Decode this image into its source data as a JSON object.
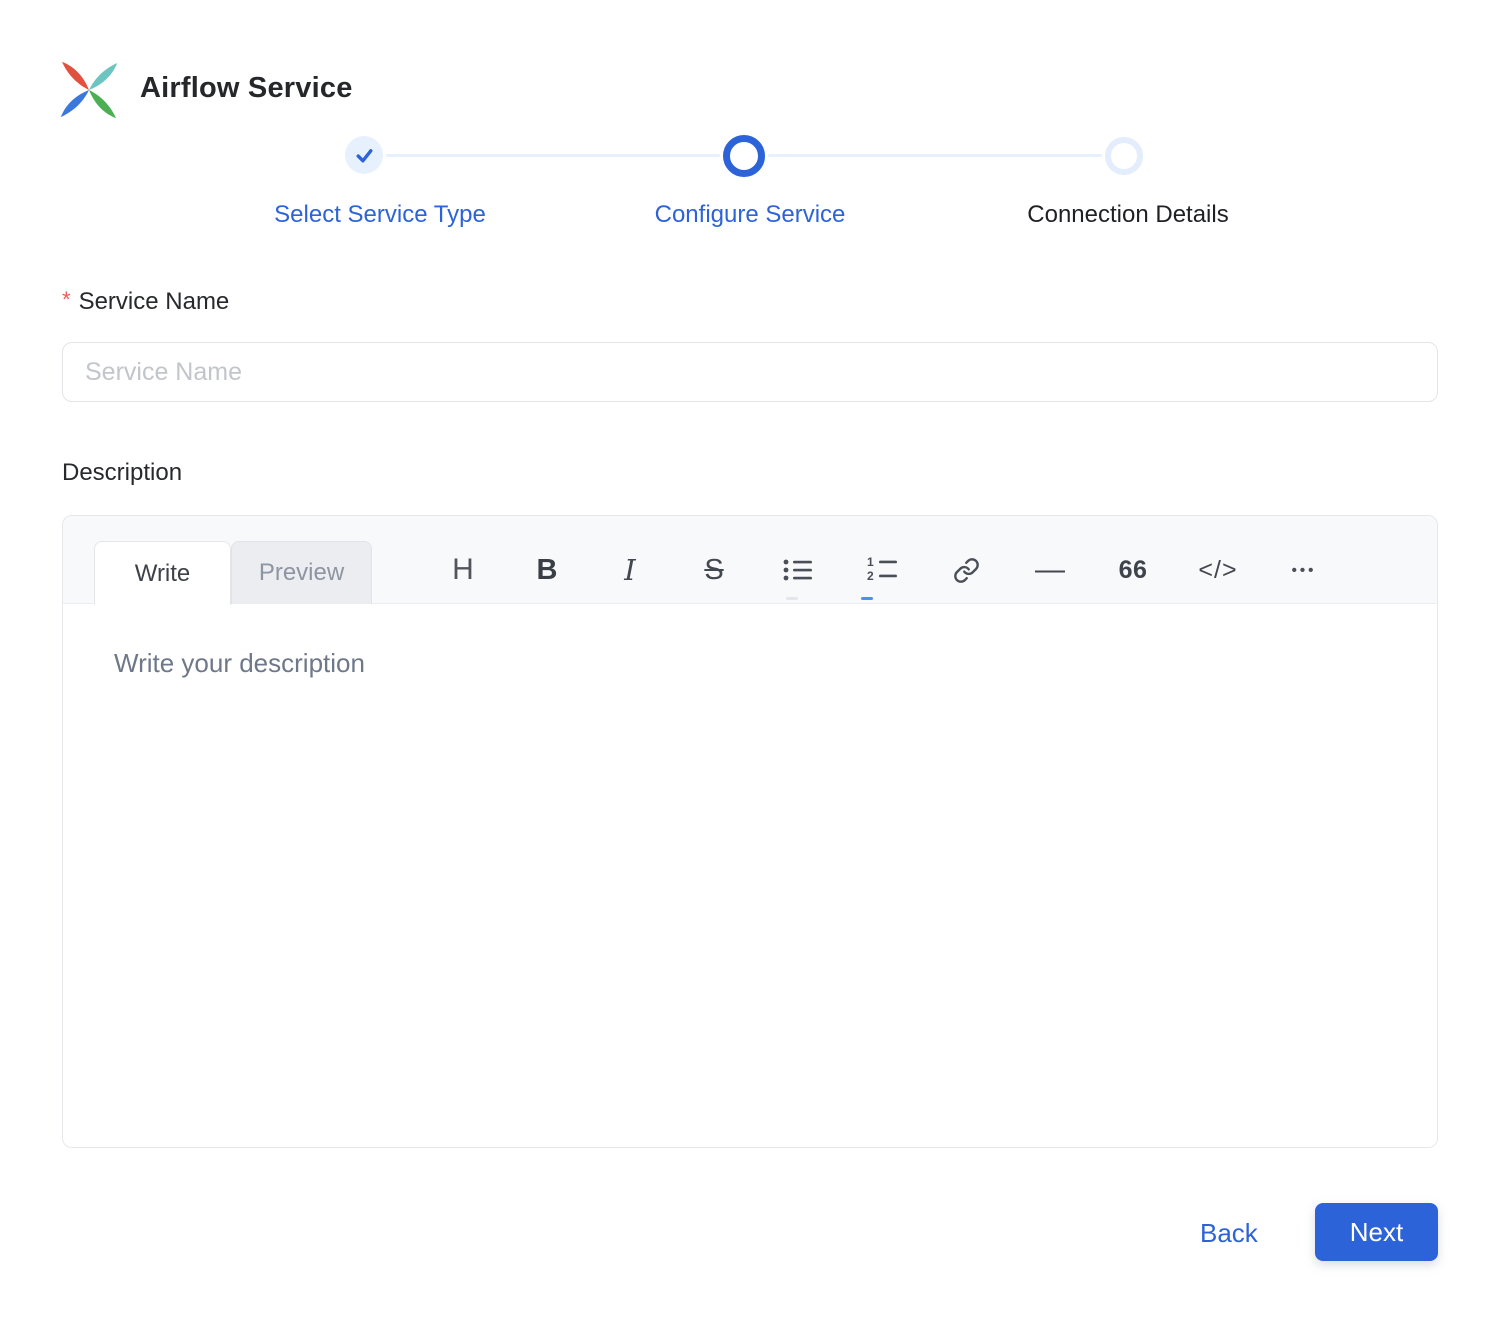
{
  "header": {
    "title": "Airflow Service",
    "logo": "airflow-logo"
  },
  "stepper": {
    "steps": [
      {
        "label": "Select Service Type",
        "state": "completed"
      },
      {
        "label": "Configure Service",
        "state": "active"
      },
      {
        "label": "Connection Details",
        "state": "upcoming"
      }
    ]
  },
  "form": {
    "service_name": {
      "required_marker": "*",
      "label": "Service Name",
      "placeholder": "Service Name",
      "value": ""
    },
    "description": {
      "label": "Description",
      "editor": {
        "tabs": [
          {
            "label": "Write",
            "active": true
          },
          {
            "label": "Preview",
            "active": false
          }
        ],
        "toolbar": {
          "heading": "H",
          "bold": "B",
          "italic": "I",
          "strikethrough": "S",
          "bulleted_list": "bulleted-list-icon",
          "numbered_list": "numbered-list-icon",
          "link": "link-icon",
          "horizontal_rule": "—",
          "quote": "66",
          "code": "</>",
          "more": "•••"
        },
        "placeholder": "Write your description",
        "value": ""
      }
    }
  },
  "footer": {
    "back_label": "Back",
    "next_label": "Next"
  },
  "colors": {
    "primary_blue": "#2d63d8",
    "step_done_fill": "#e7f1fd",
    "step_line": "#e7f0fc",
    "required_red": "#ee5a54",
    "airflow_red": "#e2513f",
    "airflow_teal": "#6cc5c1",
    "airflow_green": "#4daf54",
    "airflow_blue": "#3b78dd"
  }
}
